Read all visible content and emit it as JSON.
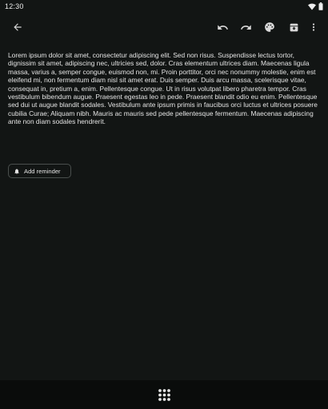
{
  "status_bar": {
    "time": "12:30",
    "icons": [
      "wifi-icon",
      "battery-icon"
    ]
  },
  "toolbar": {
    "back_icon": "arrow-back-icon",
    "undo_icon": "undo-icon",
    "redo_icon": "redo-icon",
    "palette_icon": "palette-icon",
    "archive_icon": "archive-icon",
    "more_icon": "more-vert-icon"
  },
  "note": {
    "text": "Lorem ipsum dolor sit amet, consectetur adipiscing elit. Sed non risus. Suspendisse lectus tortor, dignissim sit amet, adipiscing nec, ultricies sed, dolor. Cras elementum ultrices diam. Maecenas ligula massa, varius a, semper congue, euismod non, mi. Proin porttitor, orci nec nonummy molestie, enim est eleifend mi, non fermentum diam nisl sit amet erat. Duis semper. Duis arcu massa, scelerisque vitae, consequat in, pretium a, enim. Pellentesque congue. Ut in risus volutpat libero pharetra tempor. Cras vestibulum bibendum augue. Praesent egestas leo in pede. Praesent blandit odio eu enim. Pellentesque sed dui ut augue blandit sodales. Vestibulum ante ipsum primis in faucibus orci luctus et ultrices posuere cubilia Curae; Aliquam nibh. Mauris ac mauris sed pede pellentesque fermentum. Maecenas adipiscing ante non diam sodales hendrerit."
  },
  "reminder": {
    "label": "Add reminder",
    "icon": "bell-icon"
  },
  "bottom_bar": {
    "icon": "apps-grid-icon"
  }
}
